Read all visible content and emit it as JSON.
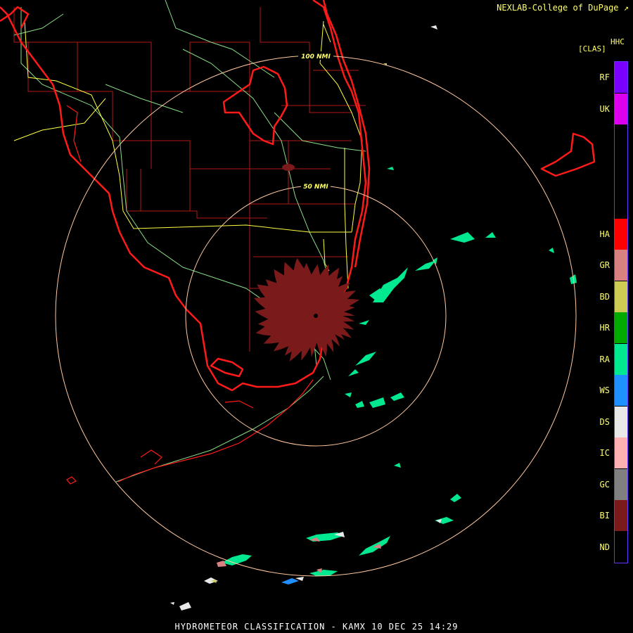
{
  "credit": "NEXLAB-College of DuPage",
  "credit_icon": "external-link-icon",
  "legend": {
    "title_top": "HHC",
    "title_bottom": "[CLAS]",
    "categories": [
      {
        "code": "RF",
        "color": "#7a00ff"
      },
      {
        "code": "UK",
        "color": "#dd00ee"
      },
      {
        "code": "",
        "color": "#000000"
      },
      {
        "code": "",
        "color": "#000000"
      },
      {
        "code": "",
        "color": "#000000"
      },
      {
        "code": "HA",
        "color": "#ff0000"
      },
      {
        "code": "GR",
        "color": "#d98080"
      },
      {
        "code": "BD",
        "color": "#cccc55"
      },
      {
        "code": "HR",
        "color": "#00aa00"
      },
      {
        "code": "RA",
        "color": "#00e890"
      },
      {
        "code": "WS",
        "color": "#1e90ff"
      },
      {
        "code": "DS",
        "color": "#e8e8e8"
      },
      {
        "code": "IC",
        "color": "#ffb0b0"
      },
      {
        "code": "GC",
        "color": "#808080"
      },
      {
        "code": "BI",
        "color": "#7a1a1a"
      },
      {
        "code": "ND",
        "color": "#000000"
      }
    ]
  },
  "range_rings": [
    {
      "label": "50 NMI"
    },
    {
      "label": "100 NMI"
    }
  ],
  "footer": "HYDROMETEOR CLASSIFICATION - KAMX 10 DEC 25 14:29",
  "colors": {
    "coast": "#ff2020",
    "county": "#cc2020",
    "highway": "#ffff44",
    "road": "#88dd88",
    "ring": "#ffc8a0",
    "biological": "#7a1a1a",
    "rain": "#00e890"
  }
}
